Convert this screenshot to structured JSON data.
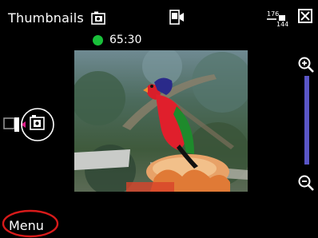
{
  "header": {
    "title": "Thumbnails",
    "title_icon": "video-camera-icon",
    "mode_icon": "camera-mode-icon",
    "resolution_icon": "resolution-icon",
    "resolution_top": "176",
    "resolution_bottom": "144",
    "close_icon": "close-icon"
  },
  "status": {
    "recording_color": "#19c03a",
    "timer": "65:30"
  },
  "viewfinder": {
    "subject": "lorikeet-parrot-preview-image"
  },
  "zoom": {
    "in_icon": "zoom-in-icon",
    "out_icon": "zoom-out-icon",
    "track_color": "#5a56c7"
  },
  "side": {
    "switch_icon": "camera-video-switch-icon"
  },
  "softkeys": {
    "left": "Menu"
  },
  "colors": {
    "background": "#000000",
    "annotation": "#d81a1a"
  }
}
